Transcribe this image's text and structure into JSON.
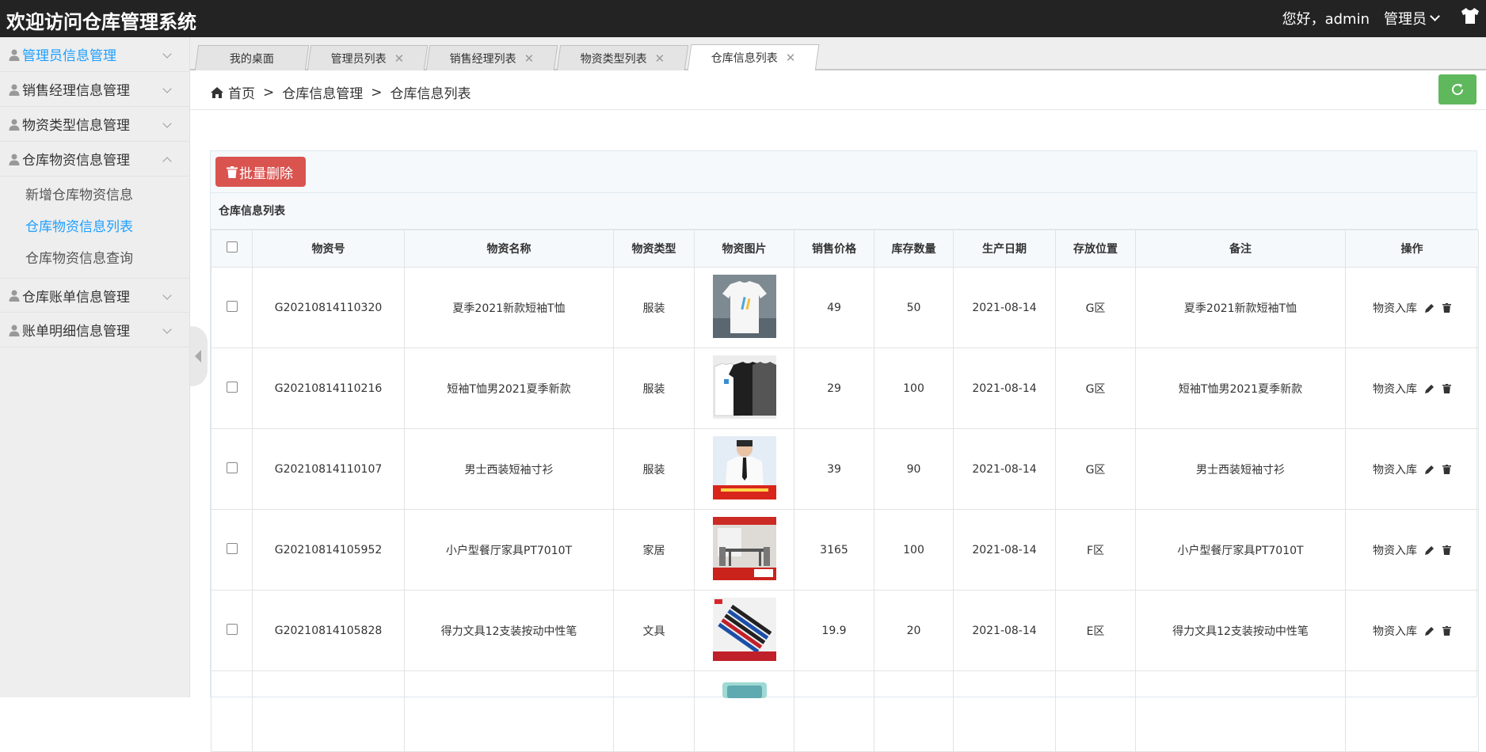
{
  "header": {
    "title": "欢迎访问仓库管理系统",
    "greeting": "您好，admin",
    "role": "管理员"
  },
  "sidebar": {
    "items": [
      {
        "label": "管理员信息管理"
      },
      {
        "label": "销售经理信息管理"
      },
      {
        "label": "物资类型信息管理"
      },
      {
        "label": "仓库物资信息管理"
      },
      {
        "label": "仓库账单信息管理"
      },
      {
        "label": "账单明细信息管理"
      }
    ],
    "submenu": [
      {
        "label": "新增仓库物资信息"
      },
      {
        "label": "仓库物资信息列表"
      },
      {
        "label": "仓库物资信息查询"
      }
    ]
  },
  "tabs": [
    {
      "label": "我的桌面"
    },
    {
      "label": "管理员列表"
    },
    {
      "label": "销售经理列表"
    },
    {
      "label": "物资类型列表"
    },
    {
      "label": "仓库信息列表"
    }
  ],
  "breadcrumb": {
    "home": "首页",
    "sep": ">",
    "level1": "仓库信息管理",
    "level2": "仓库信息列表"
  },
  "toolbar": {
    "batch_delete": "批量删除"
  },
  "table": {
    "title": "仓库信息列表",
    "columns": [
      "物资号",
      "物资名称",
      "物资类型",
      "物资图片",
      "销售价格",
      "库存数量",
      "生产日期",
      "存放位置",
      "备注",
      "操作"
    ],
    "op_label": "物资入库",
    "rows": [
      {
        "id": "G20210814110320",
        "name": "夏季2021新款短袖T恤",
        "type": "服装",
        "img": "tshirt-white-photo",
        "price": "49",
        "qty": "50",
        "date": "2021-08-14",
        "loc": "G区",
        "note": "夏季2021新款短袖T恤"
      },
      {
        "id": "G20210814110216",
        "name": "短袖T恤男2021夏季新款",
        "type": "服装",
        "img": "tshirt-pair-photo",
        "price": "29",
        "qty": "100",
        "date": "2021-08-14",
        "loc": "G区",
        "note": "短袖T恤男2021夏季新款"
      },
      {
        "id": "G20210814110107",
        "name": "男士西装短袖寸衫",
        "type": "服装",
        "img": "shirt-model-photo",
        "price": "39",
        "qty": "90",
        "date": "2021-08-14",
        "loc": "G区",
        "note": "男士西装短袖寸衫"
      },
      {
        "id": "G20210814105952",
        "name": "小户型餐厅家具PT7010T",
        "type": "家居",
        "img": "dining-table-photo",
        "price": "3165",
        "qty": "100",
        "date": "2021-08-14",
        "loc": "F区",
        "note": "小户型餐厅家具PT7010T"
      },
      {
        "id": "G20210814105828",
        "name": "得力文具12支装按动中性笔",
        "type": "文具",
        "img": "pens-photo",
        "price": "19.9",
        "qty": "20",
        "date": "2021-08-14",
        "loc": "E区",
        "note": "得力文具12支装按动中性笔"
      }
    ]
  },
  "colors": {
    "accent": "#1e9fff",
    "danger": "#d9534f",
    "success": "#5fb85c",
    "topbar": "#232323"
  }
}
